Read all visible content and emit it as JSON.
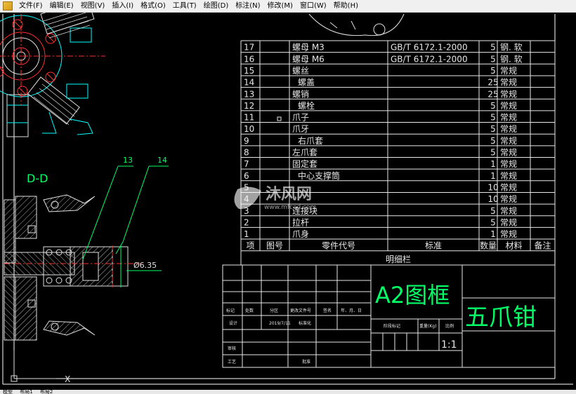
{
  "menu": {
    "items": [
      "文件(F)",
      "编辑(E)",
      "视图(V)",
      "插入(I)",
      "格式(O)",
      "工具(T)",
      "绘图(D)",
      "标注(N)",
      "修改(M)",
      "窗口(W)",
      "帮助(H)"
    ]
  },
  "drawing": {
    "section_label": "D-D",
    "callout_13": "13",
    "callout_14": "14",
    "dimension": "Ø6.35",
    "ucs_x": "X"
  },
  "bom": {
    "rows": [
      {
        "no": "17",
        "code": "",
        "name": "螺母    M3",
        "std": "GB/T 6172.1-2000",
        "qty": "5",
        "mat": "钢. 软",
        "note": ""
      },
      {
        "no": "16",
        "code": "",
        "name": "螺母    M6",
        "std": "GB/T 6172.1-2000",
        "qty": "5",
        "mat": "钢. 软",
        "note": ""
      },
      {
        "no": "15",
        "code": "",
        "name": "螺丝",
        "std": "",
        "qty": "5",
        "mat": "常规",
        "note": ""
      },
      {
        "no": "14",
        "code": "",
        "name": "螺盖",
        "std": "",
        "qty": "25",
        "mat": "常规",
        "note": ""
      },
      {
        "no": "13",
        "code": "",
        "name": "螺销",
        "std": "",
        "qty": "25",
        "mat": "常规",
        "note": ""
      },
      {
        "no": "12",
        "code": "",
        "name": "螺栓",
        "std": "",
        "qty": "5",
        "mat": "常规",
        "note": ""
      },
      {
        "no": "11",
        "code": "",
        "name": "爪子",
        "std": "",
        "qty": "5",
        "mat": "常规",
        "note": ""
      },
      {
        "no": "10",
        "code": "",
        "name": "爪牙",
        "std": "",
        "qty": "5",
        "mat": "常规",
        "note": ""
      },
      {
        "no": "9",
        "code": "",
        "name": "右爪套",
        "std": "",
        "qty": "5",
        "mat": "常规",
        "note": ""
      },
      {
        "no": "8",
        "code": "",
        "name": "左爪套",
        "std": "",
        "qty": "5",
        "mat": "常规",
        "note": ""
      },
      {
        "no": "7",
        "code": "",
        "name": "固定套",
        "std": "",
        "qty": "1",
        "mat": "常规",
        "note": ""
      },
      {
        "no": "6",
        "code": "",
        "name": "中心支撑筒",
        "std": "",
        "qty": "1",
        "mat": "常规",
        "note": ""
      },
      {
        "no": "5",
        "code": "",
        "name": "",
        "std": "",
        "qty": "10",
        "mat": "常规",
        "note": ""
      },
      {
        "no": "4",
        "code": "",
        "name": "",
        "std": "",
        "qty": "10",
        "mat": "常规",
        "note": ""
      },
      {
        "no": "3",
        "code": "",
        "name": "连接块",
        "std": "",
        "qty": "5",
        "mat": "常规",
        "note": ""
      },
      {
        "no": "2",
        "code": "",
        "name": "拉杆",
        "std": "",
        "qty": "5",
        "mat": "常规",
        "note": ""
      },
      {
        "no": "1",
        "code": "",
        "name": "爪身",
        "std": "",
        "qty": "1",
        "mat": "常规",
        "note": ""
      }
    ],
    "header": [
      "项",
      "图号",
      "零件代号",
      "标准",
      "数量",
      "材料",
      "备注"
    ],
    "caption": "明细栏"
  },
  "title_block": {
    "frame_label": "A2图框",
    "product_name": "五爪钳",
    "scale": "1:1",
    "cells": {
      "mark": "标记",
      "count": "处数",
      "zone": "分区",
      "change_doc": "更改文件号",
      "sign": "签名",
      "date": "年、月、日",
      "design": "设计",
      "design_date": "2019/7/11",
      "standardize": "标准化",
      "stage_mark": "阶段标记",
      "weight": "重量(Kg)",
      "ratio": "比例",
      "review": "审核",
      "process": "工艺",
      "approve": "批准"
    }
  },
  "watermark": {
    "text": "沐风网",
    "url": "www.mfcad.com"
  },
  "layout_tabs": [
    "模型",
    "布局1",
    "布局2"
  ]
}
